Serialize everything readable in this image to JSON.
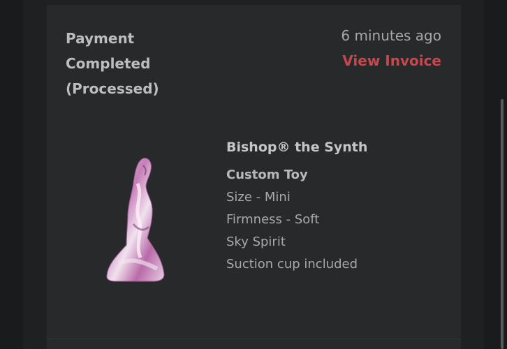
{
  "order_event": {
    "status_lines": [
      "Payment",
      "Completed",
      "(Processed)"
    ],
    "time_ago": "6 minutes ago",
    "invoice_link": "View Invoice"
  },
  "product": {
    "name": "Bishop® the Synth",
    "options": [
      "Custom Toy",
      "Size - Mini",
      "Firmness - Soft",
      "Sky Spirit",
      "Suction cup included"
    ]
  },
  "colors": {
    "background": "#1a1b1d",
    "card": "#28292b",
    "accent_link": "#c9464d",
    "product_pink": "#cc8fc1"
  }
}
